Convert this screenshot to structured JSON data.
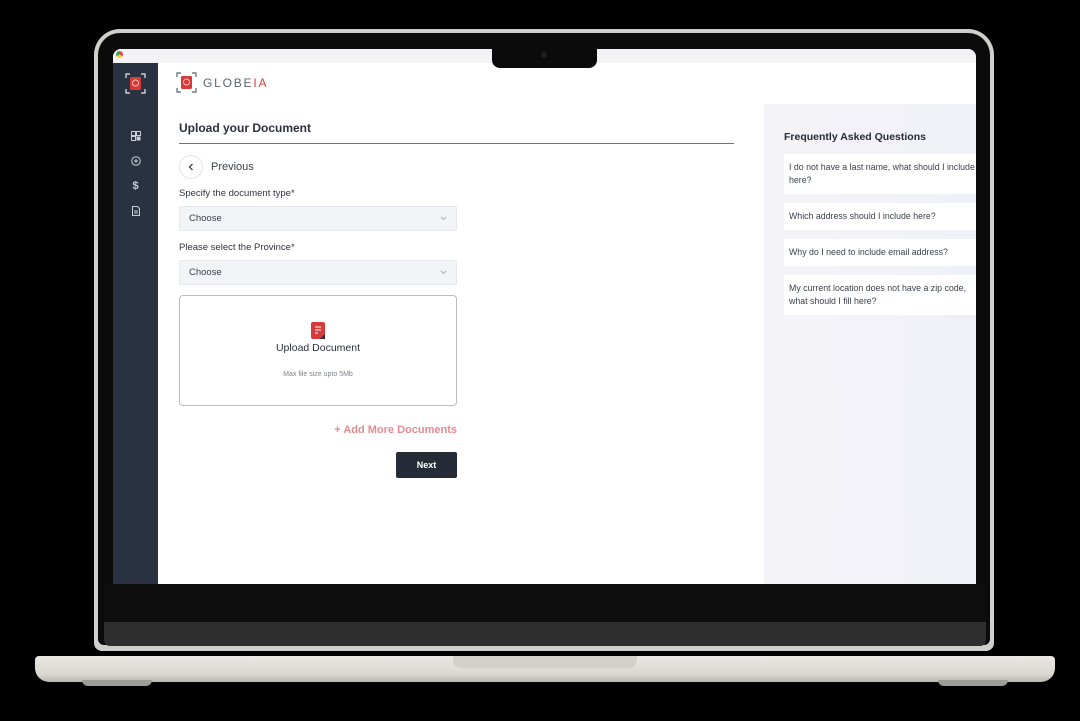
{
  "app": {
    "brand_prefix": "GLOBE",
    "brand_accent": "IA",
    "accent_color": "#d63a3a",
    "sidebar_color": "#2a3140"
  },
  "sidebar": {
    "items": [
      {
        "icon": "dashboard-icon",
        "label": "Dashboard"
      },
      {
        "icon": "add-circle-icon",
        "label": "Add"
      },
      {
        "icon": "dollar-icon",
        "label": "Payments"
      },
      {
        "icon": "document-icon",
        "label": "Documents"
      }
    ]
  },
  "main": {
    "title": "Upload your Document",
    "previous_label": "Previous",
    "document_type": {
      "label": "Specify the document type*",
      "value": "Choose"
    },
    "province": {
      "label": "Please select the Province*",
      "value": "Choose"
    },
    "upload": {
      "title": "Upload Document",
      "hint": "Max file size upto 5Mb"
    },
    "add_more_label": "+ Add More Documents",
    "next_label": "Next"
  },
  "faq": {
    "title": "Frequently Asked Questions",
    "items": [
      "I do not have a last name, what should I include here?",
      "Which address should I include here?",
      "Why do I need to include email address?",
      "My current location does not have a zip code, what should I fill here?"
    ]
  }
}
